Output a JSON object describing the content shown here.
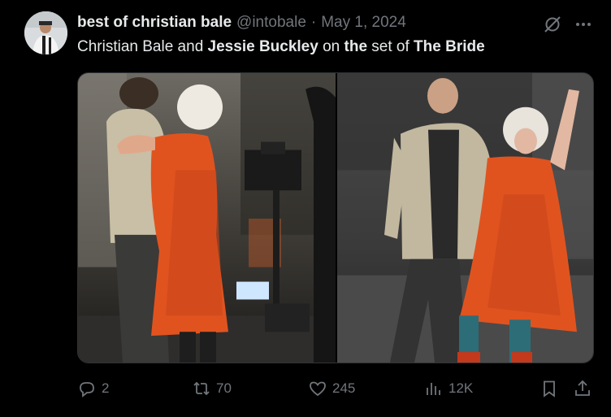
{
  "post": {
    "display_name": "best of christian bale",
    "handle": "@intobale",
    "separator": "·",
    "date": "May 1, 2024",
    "text_parts": [
      {
        "t": "Christian Bale and ",
        "bold": false
      },
      {
        "t": "Jessie Buckley",
        "bold": true
      },
      {
        "t": " on ",
        "bold": false
      },
      {
        "t": "the",
        "bold": true
      },
      {
        "t": " set of ",
        "bold": false
      },
      {
        "t": "The Bride",
        "bold": true
      }
    ]
  },
  "icons": {
    "grok": "grok-icon",
    "more": "more-icon",
    "reply": "reply-icon",
    "retweet": "retweet-icon",
    "like": "heart-icon",
    "views": "views-icon",
    "bookmark": "bookmark-icon",
    "share": "share-icon"
  },
  "actions": {
    "replies": "2",
    "reposts": "70",
    "likes": "245",
    "views": "12K"
  },
  "colors": {
    "background": "#000000",
    "text": "#e7e9ea",
    "muted": "#71767b",
    "dress": "#e0531f"
  }
}
